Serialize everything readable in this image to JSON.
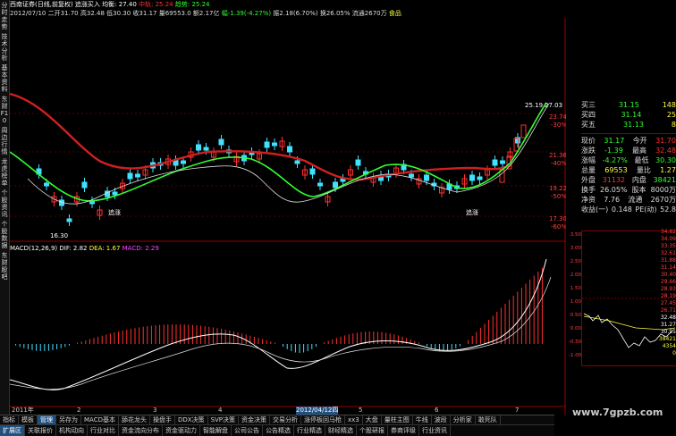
{
  "sidebar_tabs": [
    "分时走势",
    "技术分析",
    "基本资料",
    "东财F10",
    "周边行情",
    "龙虎榜单",
    "个股资讯",
    "个股数据",
    "东财股吧"
  ],
  "infobar1": {
    "name": "西南证券(日线,前复权)",
    "indicator": "追涨买入",
    "avg_label": "均衡: 27.40",
    "mid_label": "中轨: 25.24",
    "trend_label": "趋势: 25.24"
  },
  "infobar2": {
    "date": "2012/07/10",
    "open": "二开31.70",
    "high": "高32.48",
    "low": "低30.30",
    "close": "收31.17",
    "volume": "量69553.0",
    "amount": "额2.17亿",
    "change": "幅-1.39(-4.27%)",
    "amplitude": "振2.18(6.70%)",
    "turnover": "换26.05%",
    "float": "流通2670万",
    "sector": "食品"
  },
  "price_labels": {
    "p1": "23.74",
    "p1pct": "-30%",
    "p2": "21.36",
    "p2pct": "-40%",
    "p3": "19.22",
    "p3pct": "-50%",
    "p4": "17.30",
    "p4pct": "-60%",
    "top1": "25.19",
    "top2": "27.03",
    "low_marker": "16.30",
    "buy_label1": "追涨",
    "buy_label2": "追涨"
  },
  "macd_header": {
    "name": "MACD(12,26,9)",
    "dif": "DIF: 2.82",
    "dea": "DEA: 1.67",
    "macd": "MACD: 2.29"
  },
  "x_ticks": [
    "2011年",
    "2",
    "3",
    "4",
    "2012/04/12四",
    "5",
    "6",
    "7"
  ],
  "quote": {
    "rows": [
      {
        "label": "买三",
        "val": "31.15",
        "extra": "148"
      },
      {
        "label": "买四",
        "val": "31.14",
        "extra": "25"
      },
      {
        "label": "买五",
        "val": "31.13",
        "extra": "8"
      }
    ],
    "stats": [
      {
        "l1": "现价",
        "v1": "31.17",
        "l2": "今开",
        "v2": "31.70"
      },
      {
        "l1": "涨跌",
        "v1": "-1.39",
        "l2": "最高",
        "v2": "32.48"
      },
      {
        "l1": "涨幅",
        "v1": "-4.27%",
        "l2": "最低",
        "v2": "30.30"
      },
      {
        "l1": "总量",
        "v1": "69553",
        "l2": "量比",
        "v2": "1.27"
      },
      {
        "l1": "外盘",
        "v1": "31132",
        "l2": "内盘",
        "v2": "38421"
      },
      {
        "l1": "换手",
        "v1": "26.05%",
        "l2": "股本",
        "v2": "8000万"
      },
      {
        "l1": "净资",
        "v1": "7.76",
        "l2": "流通",
        "v2": "2670万"
      },
      {
        "l1": "收益(一)",
        "v1": "0.148",
        "l2": "PE(动)",
        "v2": "52.8"
      }
    ]
  },
  "mini_axis": [
    "34.82",
    "34.09",
    "33.35",
    "32.61",
    "31.88",
    "31.14",
    "30.40",
    "29.66",
    "28.93",
    "28.19",
    "27.45",
    "26.71"
  ],
  "mini_left_axis": [
    "3.50",
    "3.00",
    "2.50",
    "2.00",
    "1.50",
    "1.00",
    "0.50",
    "0.00",
    "-0.50",
    "-1.00"
  ],
  "mini_vol": [
    "38421",
    "4354",
    "0"
  ],
  "mini_right_vals": [
    "32.48",
    "31.27",
    "30.95"
  ],
  "bottom_tabs1": [
    "指标",
    "模板",
    "管理",
    "另存为",
    "MACD基本",
    "舔花龙头",
    "操盘手",
    "DDX决策",
    "SVP决策",
    "资金决策",
    "交易分析",
    "涨停板回马枪",
    "xx3",
    "大盘",
    "量柱主图",
    "牛线",
    "波段",
    "分析家",
    "敢死队"
  ],
  "bottom_tabs2": [
    "扩展区",
    "关联报价",
    "机构动向",
    "行业对比",
    "资金流向分布",
    "资金驱动力",
    "智能解盘",
    "公司公告",
    "公告精选",
    "行业精选",
    "财经精选",
    "个股研报",
    "券商评级",
    "行业资讯"
  ],
  "watermark": "www.7gpzb.com",
  "colors": {
    "red": "#ff3030",
    "green": "#30ff30",
    "white": "#ffffff",
    "cyan": "#40e0ff",
    "yellow": "#ffff40",
    "magenta": "#ff40ff"
  }
}
